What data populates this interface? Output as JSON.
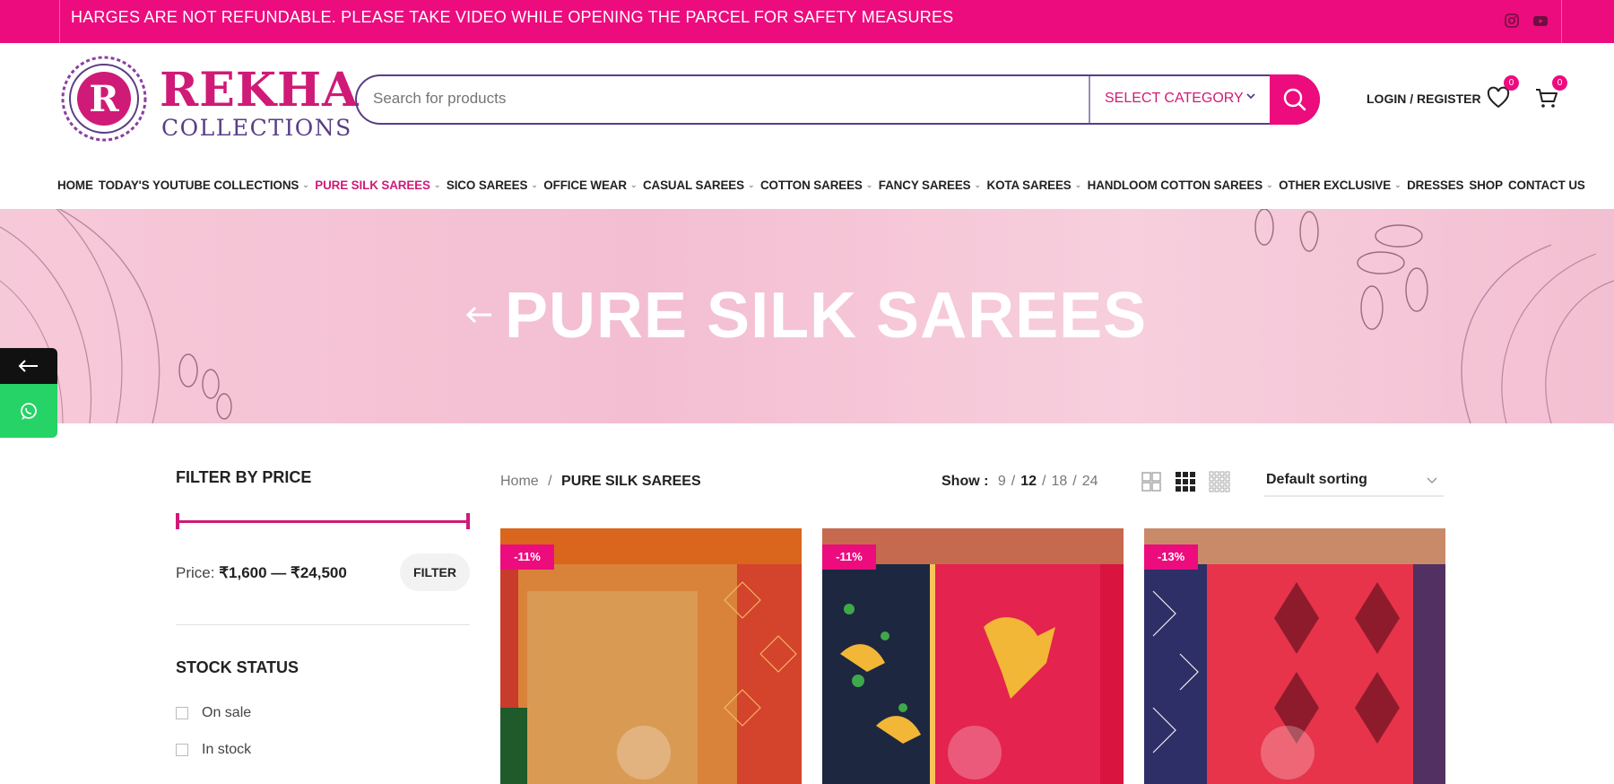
{
  "announcement": "HARGES ARE NOT REFUNDABLE. PLEASE TAKE VIDEO WHILE OPENING THE PARCEL FOR SAFETY MEASURES",
  "brand": {
    "name": "REKHA",
    "sub": "COLLECTIONS",
    "primary": "#ec0c7e",
    "secondary": "#5a3d86"
  },
  "search": {
    "placeholder": "Search for products",
    "category": "SELECT CATEGORY"
  },
  "header": {
    "login": "LOGIN / REGISTER",
    "wishlist_count": "0",
    "cart_count": "0"
  },
  "nav": [
    {
      "label": "HOME",
      "dropdown": false,
      "active": false
    },
    {
      "label": "TODAY'S YOUTUBE COLLECTIONS",
      "dropdown": true,
      "active": false
    },
    {
      "label": "PURE SILK SAREES",
      "dropdown": true,
      "active": true
    },
    {
      "label": "SICO SAREES",
      "dropdown": true,
      "active": false
    },
    {
      "label": "OFFICE WEAR",
      "dropdown": true,
      "active": false
    },
    {
      "label": "CASUAL SAREES",
      "dropdown": true,
      "active": false
    },
    {
      "label": "COTTON SAREES",
      "dropdown": true,
      "active": false
    },
    {
      "label": "FANCY SAREES",
      "dropdown": true,
      "active": false
    },
    {
      "label": "KOTA SAREES",
      "dropdown": true,
      "active": false
    },
    {
      "label": "HANDLOOM COTTON SAREES",
      "dropdown": true,
      "active": false
    },
    {
      "label": "OTHER EXCLUSIVE",
      "dropdown": true,
      "active": false
    },
    {
      "label": "DRESSES",
      "dropdown": false,
      "active": false
    },
    {
      "label": "SHOP",
      "dropdown": false,
      "active": false
    },
    {
      "label": "CONTACT US",
      "dropdown": false,
      "active": false
    }
  ],
  "banner": {
    "title": "PURE SILK SAREES"
  },
  "sidebar": {
    "filter_title": "FILTER BY PRICE",
    "price_prefix": "Price:",
    "price_range": "₹1,600 — ₹24,500",
    "filter_button": "FILTER",
    "stock_title": "STOCK STATUS",
    "stock_options": [
      "On sale",
      "In stock"
    ]
  },
  "toolbar": {
    "breadcrumb_home": "Home",
    "breadcrumb_sep": "/",
    "breadcrumb_current": "PURE SILK SAREES",
    "show_label": "Show :",
    "show_options": [
      "9",
      "12",
      "18",
      "24"
    ],
    "show_active": "12",
    "sorting": "Default sorting"
  },
  "products": [
    {
      "discount": "-11%"
    },
    {
      "discount": "-11%"
    },
    {
      "discount": "-13%"
    }
  ]
}
